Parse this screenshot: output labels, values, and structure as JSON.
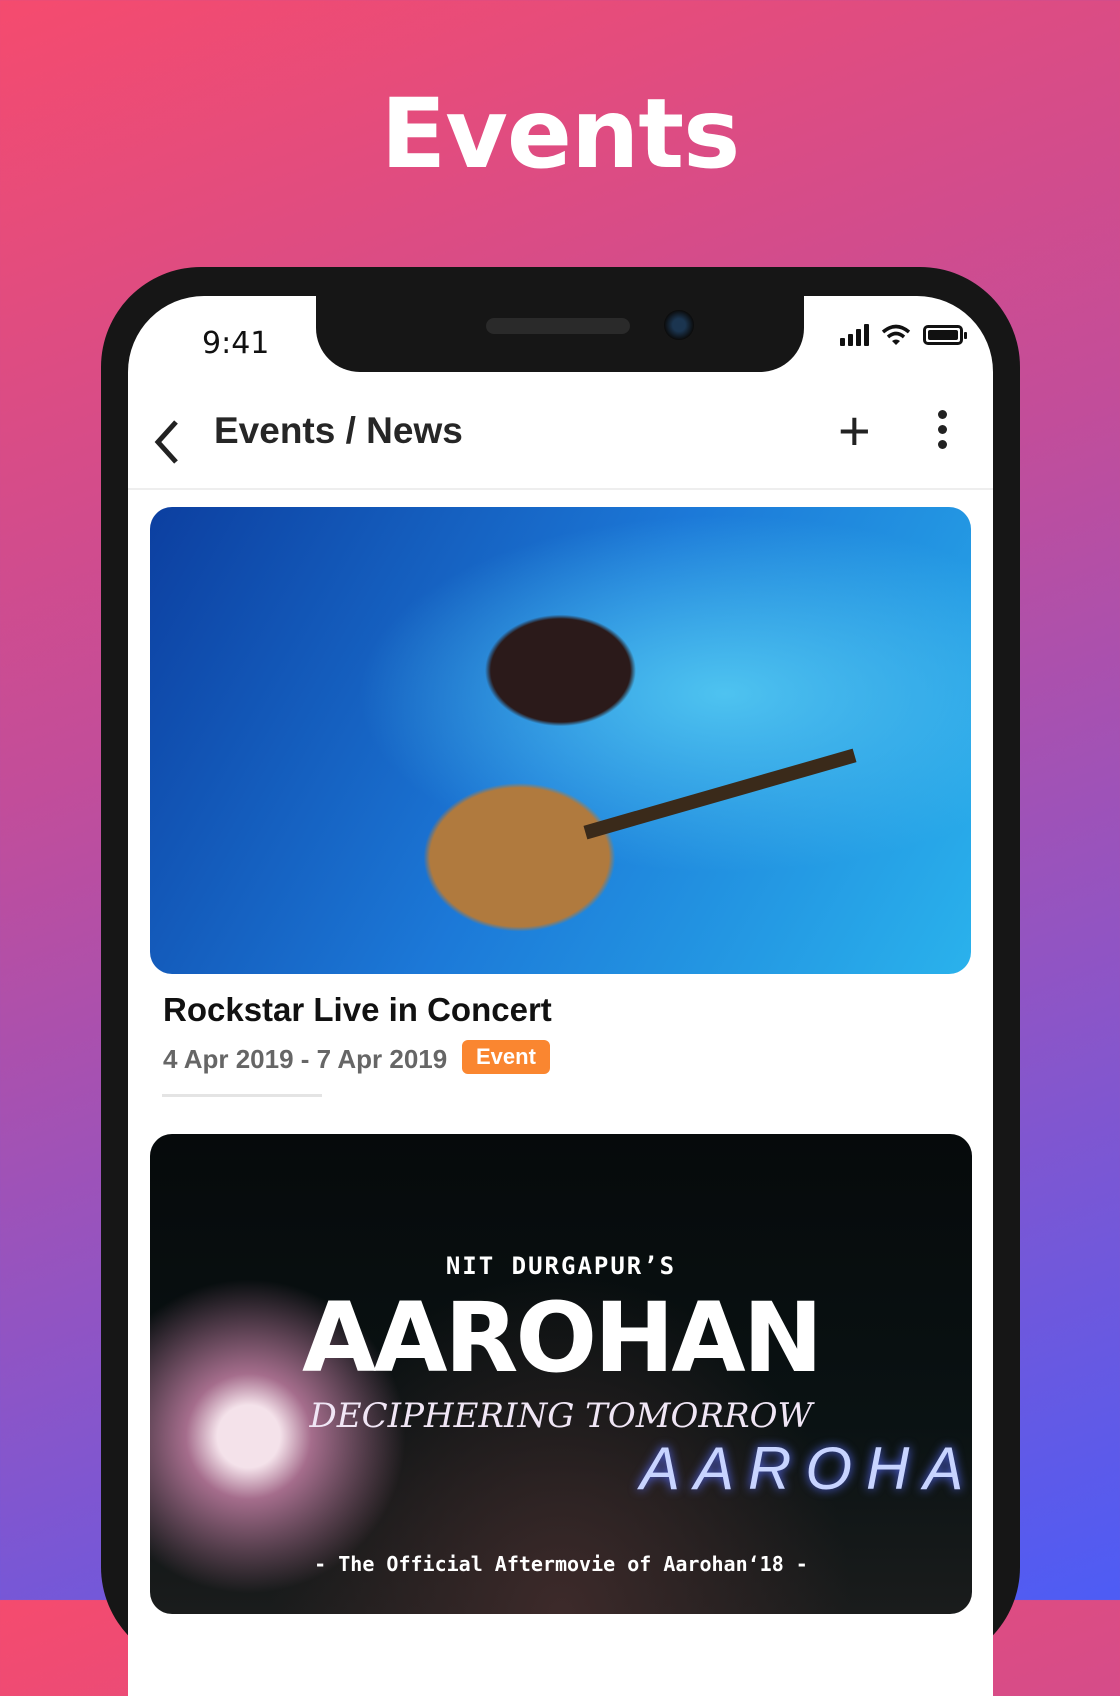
{
  "hero_title": "Events",
  "status_bar": {
    "time": "9:41"
  },
  "appbar": {
    "back_icon": "‹",
    "title": "Events / News",
    "add_icon": "+"
  },
  "cards": [
    {
      "title": "Rockstar Live in Concert",
      "date": "4 Apr 2019 - 7 Apr 2019",
      "badge": "Event",
      "badge_color": "#fa8630"
    },
    {
      "image_text": {
        "line1": "NIT DURGAPUR’S",
        "line2": "AAROHAN",
        "line3": "DECIPHERING TOMORROW",
        "neon": "AAROHAN",
        "footer": "- The Official Aftermovie of Aarohan‘18 -"
      }
    }
  ]
}
